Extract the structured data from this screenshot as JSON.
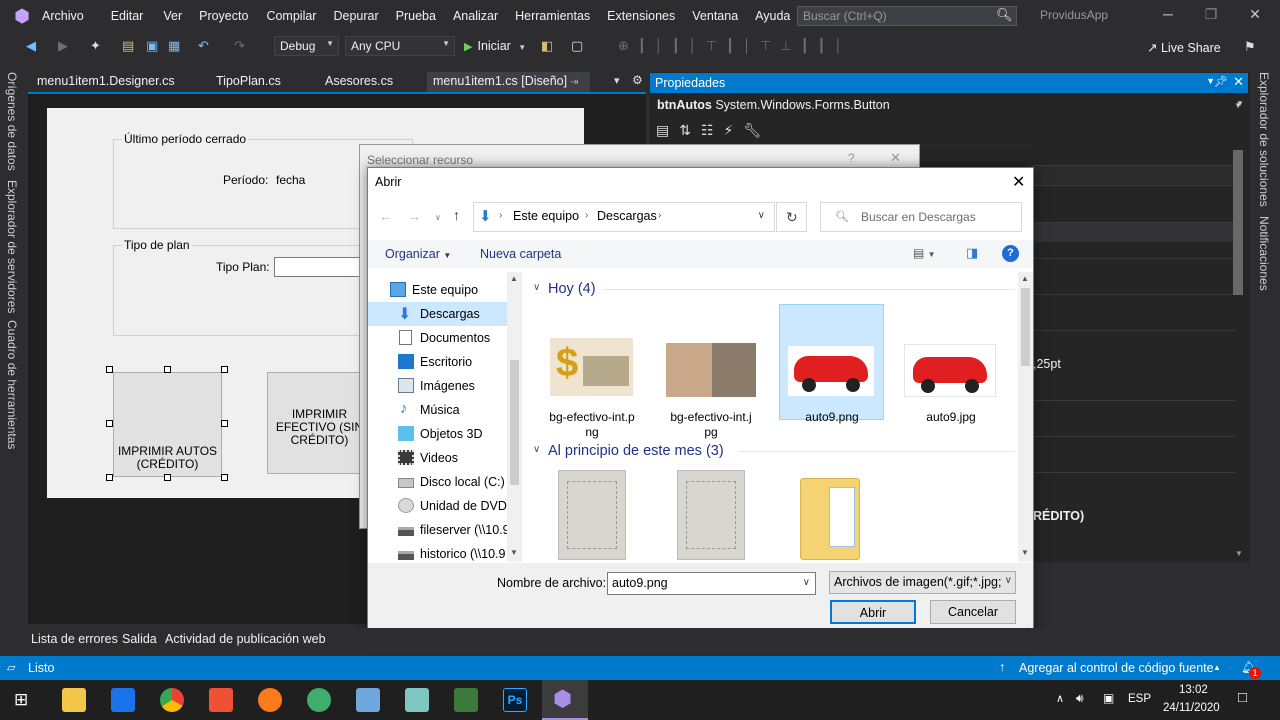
{
  "menubar": {
    "items": [
      "Archivo",
      "Editar",
      "Ver",
      "Proyecto",
      "Compilar",
      "Depurar",
      "Prueba",
      "Analizar",
      "Herramientas",
      "Extensiones",
      "Ventana",
      "Ayuda"
    ],
    "search_placeholder": "Buscar (Ctrl+Q)",
    "app_name": "ProvidusApp"
  },
  "toolbar": {
    "config": "Debug",
    "platform": "Any CPU",
    "start_label": "Iniciar",
    "liveshare_label": "Live Share"
  },
  "left_tabs": [
    "Orígenes de datos",
    "Explorador de servidores",
    "Cuadro de herramientas"
  ],
  "right_tabs": [
    "Explorador de soluciones",
    "Notificaciones"
  ],
  "doc_tabs": [
    "menu1item1.Designer.cs",
    "TipoPlan.cs",
    "Asesores.cs",
    "menu1item1.cs [Diseño]"
  ],
  "designer": {
    "group1_title": "Último período cerrado",
    "periodo_label": "Período:",
    "periodo_value": "fecha",
    "group2_title": "Tipo de plan",
    "tipo_plan_label": "Tipo Plan:",
    "btn_autos": "IMPRIMIR AUTOS (CRÉDITO)",
    "btn_efectivo": "IMPRIMIR EFECTIVO (SIN CRÉDITO)"
  },
  "properties": {
    "title": "Propiedades",
    "object_name": "btnAutos",
    "object_type": "System.Windows.Forms.Button",
    "visible_value_1": ",25pt",
    "visible_value_2": "RÉDITO)"
  },
  "resource_dialog": {
    "title": "Seleccionar recurso"
  },
  "open_dialog": {
    "title": "Abrir",
    "breadcrumb": [
      "Este equipo",
      "Descargas"
    ],
    "search_placeholder": "Buscar en Descargas",
    "organize_label": "Organizar",
    "new_folder_label": "Nueva carpeta",
    "nav_items": [
      {
        "label": "Este equipo",
        "icon": "computer-icon"
      },
      {
        "label": "Descargas",
        "icon": "download-icon"
      },
      {
        "label": "Documentos",
        "icon": "document-icon"
      },
      {
        "label": "Escritorio",
        "icon": "desktop-icon"
      },
      {
        "label": "Imágenes",
        "icon": "pictures-icon"
      },
      {
        "label": "Música",
        "icon": "music-icon"
      },
      {
        "label": "Objetos 3D",
        "icon": "cube-icon"
      },
      {
        "label": "Videos",
        "icon": "video-icon"
      },
      {
        "label": "Disco local (C:)",
        "icon": "drive-icon"
      },
      {
        "label": "Unidad de DVD R",
        "icon": "dvd-icon"
      },
      {
        "label": "fileserver (\\\\10.9",
        "icon": "network-drive-icon"
      },
      {
        "label": "historico (\\\\10.9",
        "icon": "network-drive-icon"
      }
    ],
    "group_today": "Hoy (4)",
    "group_month": "Al principio de este mes (3)",
    "files_today": [
      {
        "name": "bg-efectivo-int.png",
        "line1": "bg-efectivo-int.p",
        "line2": "ng"
      },
      {
        "name": "bg-efectivo-int.jpg",
        "line1": "bg-efectivo-int.j",
        "line2": "pg"
      },
      {
        "name": "auto9.png",
        "line1": "auto9.png",
        "line2": ""
      },
      {
        "name": "auto9.jpg",
        "line1": "auto9.jpg",
        "line2": ""
      }
    ],
    "filename_label": "Nombre de archivo:",
    "filename_value": "auto9.png",
    "filetype_value": "Archivos de imagen(*.gif;*.jpg;*",
    "open_button": "Abrir",
    "cancel_button": "Cancelar"
  },
  "bottom_tabs": [
    "Lista de errores",
    "Salida",
    "Actividad de publicación web"
  ],
  "status": {
    "left": "Listo",
    "right": "Agregar al control de código fuente",
    "notif_count": "1"
  },
  "taskbar": {
    "lang": "ESP",
    "time": "13:02",
    "date": "24/11/2020"
  },
  "colors": {
    "accent": "#007acc",
    "selection": "#cce8ff"
  }
}
